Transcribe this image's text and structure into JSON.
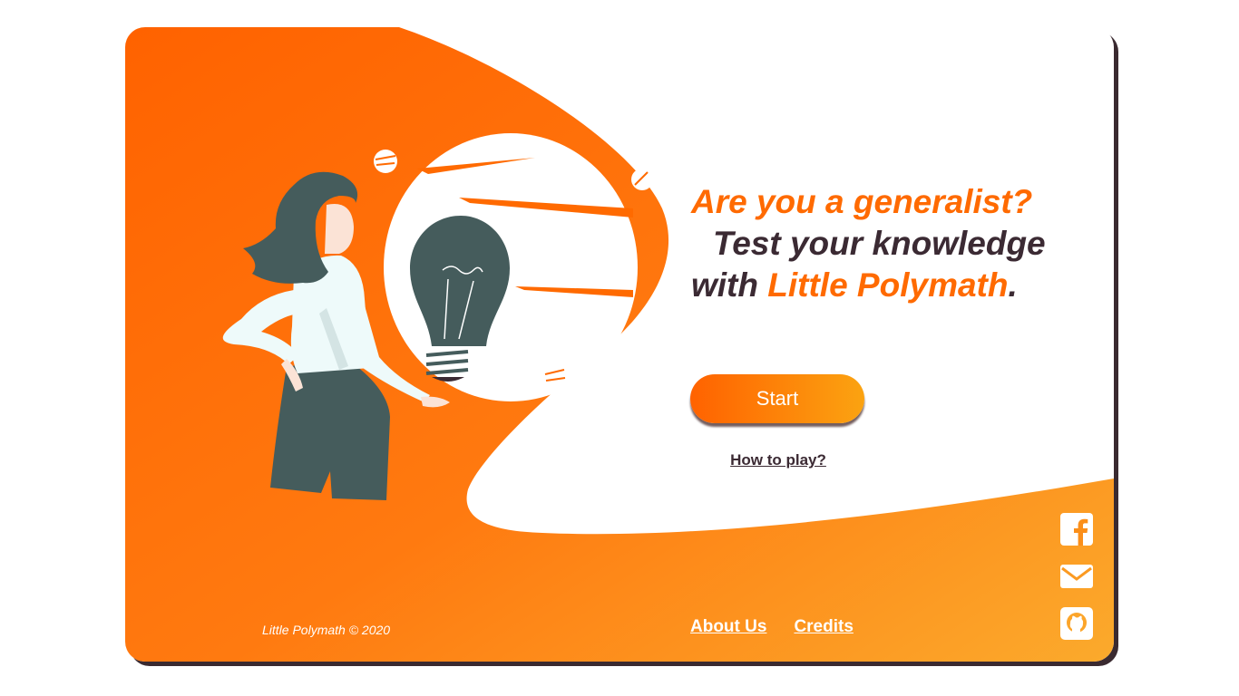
{
  "hero": {
    "line1": "Are you a generalist?",
    "line2": "Test your knowledge",
    "line3_prefix": "with ",
    "line3_brand": "Little Polymath",
    "line3_suffix": "."
  },
  "actions": {
    "start_label": "Start",
    "how_to_label": "How to play?"
  },
  "footer": {
    "copyright": "Little Polymath © 2020",
    "links": [
      "About Us",
      "Credits"
    ]
  },
  "social": {
    "icons": [
      "facebook-icon",
      "email-icon",
      "github-icon"
    ]
  },
  "colors": {
    "accent": "#ff6a00",
    "accent_light": "#fba311",
    "dark_text": "#3b2a33",
    "figure_dark": "#455c5c",
    "shirt": "#eefafa"
  }
}
